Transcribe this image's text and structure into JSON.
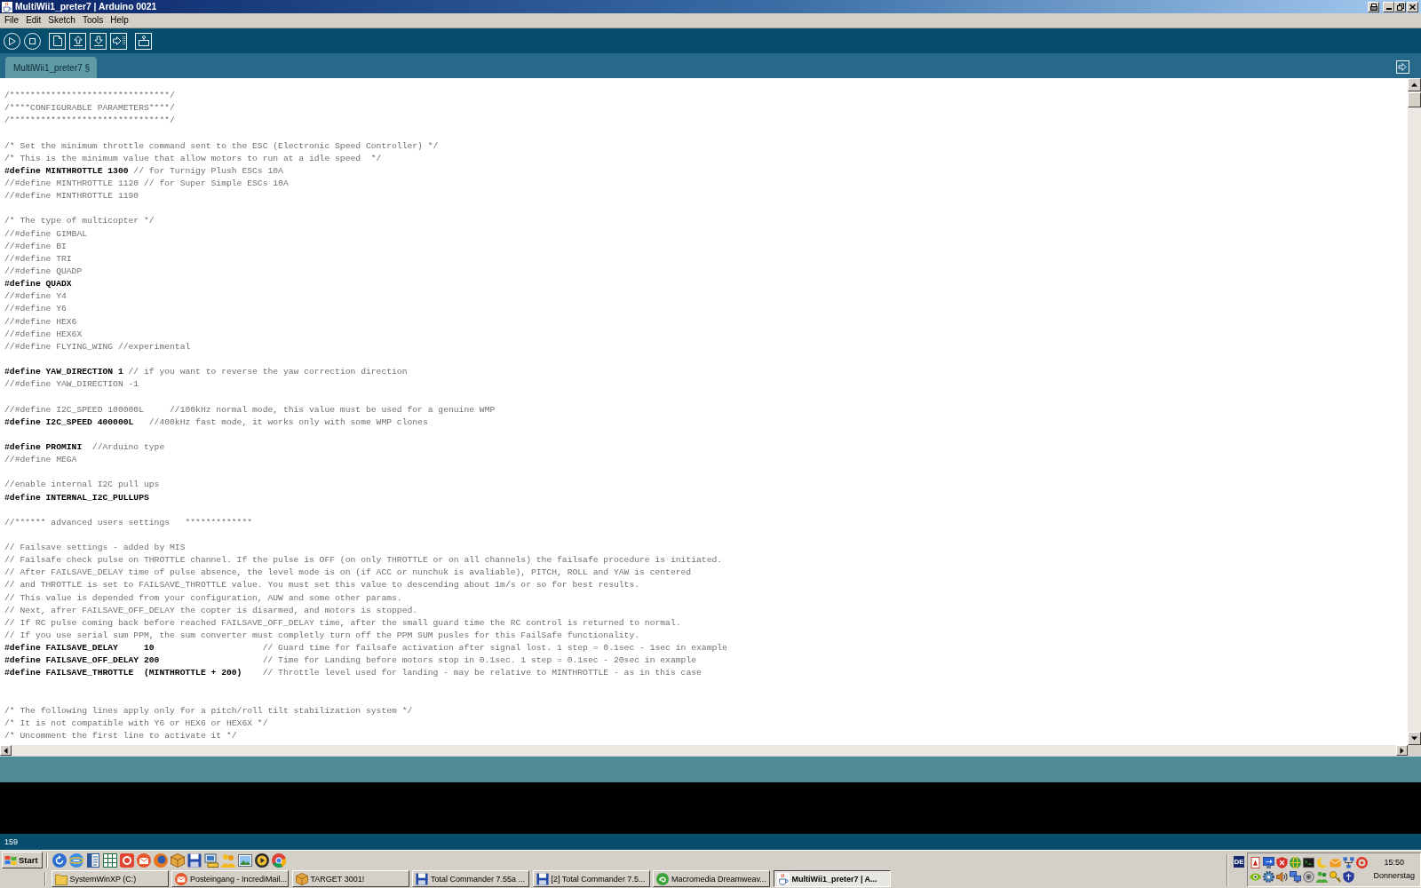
{
  "window": {
    "title": "MultiWii1_preter7 | Arduino 0021"
  },
  "menu": [
    "File",
    "Edit",
    "Sketch",
    "Tools",
    "Help"
  ],
  "tabs": [
    {
      "label": "MultiWii1_preter7 §",
      "selected": true
    }
  ],
  "editor": {
    "lines": [
      {
        "kind": "comment",
        "text": "/*******************************/"
      },
      {
        "kind": "comment",
        "text": "/****CONFIGURABLE PARAMETERS****/"
      },
      {
        "kind": "comment",
        "text": "/*******************************/"
      },
      {
        "kind": "blank"
      },
      {
        "kind": "comment",
        "text": "/* Set the minimum throttle command sent to the ESC (Electronic Speed Controller) */"
      },
      {
        "kind": "comment",
        "text": "/* This is the minimum value that allow motors to run at a idle speed  */"
      },
      {
        "kind": "mixed",
        "text": "**#define MINTHROTTLE 1300** // for Turnigy Plush ESCs 10A"
      },
      {
        "kind": "comment",
        "text": "//#define MINTHROTTLE 1120 // for Super Simple ESCs 10A"
      },
      {
        "kind": "comment",
        "text": "//#define MINTHROTTLE 1190"
      },
      {
        "kind": "blank"
      },
      {
        "kind": "comment",
        "text": "/* The type of multicopter */"
      },
      {
        "kind": "comment",
        "text": "//#define GIMBAL"
      },
      {
        "kind": "comment",
        "text": "//#define BI"
      },
      {
        "kind": "comment",
        "text": "//#define TRI"
      },
      {
        "kind": "comment",
        "text": "//#define QUADP"
      },
      {
        "kind": "directive",
        "text": "#define QUADX"
      },
      {
        "kind": "comment",
        "text": "//#define Y4"
      },
      {
        "kind": "comment",
        "text": "//#define Y6"
      },
      {
        "kind": "comment",
        "text": "//#define HEX6"
      },
      {
        "kind": "comment",
        "text": "//#define HEX6X"
      },
      {
        "kind": "comment",
        "text": "//#define FLYING_WING //experimental"
      },
      {
        "kind": "blank"
      },
      {
        "kind": "mixed",
        "text": "**#define YAW_DIRECTION 1** // if you want to reverse the yaw correction direction"
      },
      {
        "kind": "comment",
        "text": "//#define YAW_DIRECTION -1"
      },
      {
        "kind": "blank"
      },
      {
        "kind": "comment",
        "text": "//#define I2C_SPEED 100000L     //100kHz normal mode, this value must be used for a genuine WMP"
      },
      {
        "kind": "mixed",
        "text": "**#define I2C_SPEED 400000L**   //400kHz fast mode, it works only with some WMP clones"
      },
      {
        "kind": "blank"
      },
      {
        "kind": "mixed",
        "text": "**#define PROMINI**  //Arduino type"
      },
      {
        "kind": "comment",
        "text": "//#define MEGA"
      },
      {
        "kind": "blank"
      },
      {
        "kind": "comment",
        "text": "//enable internal I2C pull ups"
      },
      {
        "kind": "directive",
        "text": "#define INTERNAL_I2C_PULLUPS"
      },
      {
        "kind": "blank"
      },
      {
        "kind": "comment",
        "text": "//****** advanced users settings   *************"
      },
      {
        "kind": "blank"
      },
      {
        "kind": "comment",
        "text": "// Failsave settings - added by MIS"
      },
      {
        "kind": "comment",
        "text": "// Failsafe check pulse on THROTTLE channel. If the pulse is OFF (on only THROTTLE or on all channels) the failsafe procedure is initiated."
      },
      {
        "kind": "comment",
        "text": "// After FAILSAVE_DELAY time of pulse absence, the level mode is on (if ACC or nunchuk is avaliable), PITCH, ROLL and YAW is centered"
      },
      {
        "kind": "comment",
        "text": "// and THROTTLE is set to FAILSAVE_THROTTLE value. You must set this value to descending about 1m/s or so for best results."
      },
      {
        "kind": "comment",
        "text": "// This value is depended from your configuration, AUW and some other params."
      },
      {
        "kind": "comment",
        "text": "// Next, afrer FAILSAVE_OFF_DELAY the copter is disarmed, and motors is stopped."
      },
      {
        "kind": "comment",
        "text": "// If RC pulse coming back before reached FAILSAVE_OFF_DELAY time, after the small guard time the RC control is returned to normal."
      },
      {
        "kind": "comment",
        "text": "// If you use serial sum PPM, the sum converter must completly turn off the PPM SUM pusles for this FailSafe functionality."
      },
      {
        "kind": "mixed",
        "text": "**#define FAILSAVE_DELAY     10**                     // Guard time for failsafe activation after signal lost. 1 step = 0.1sec - 1sec in example"
      },
      {
        "kind": "mixed",
        "text": "**#define FAILSAVE_OFF_DELAY 200**                    // Time for Landing before motors stop in 0.1sec. 1 step = 0.1sec - 20sec in example"
      },
      {
        "kind": "mixed",
        "text": "**#define FAILSAVE_THROTTLE  (MINTHROTTLE + 200)**    // Throttle level used for landing - may be relative to MINTHROTTLE - as in this case"
      },
      {
        "kind": "blank"
      },
      {
        "kind": "blank"
      },
      {
        "kind": "comment",
        "text": "/* The following lines apply only for a pitch/roll tilt stabilization system */"
      },
      {
        "kind": "comment",
        "text": "/* It is not compatible with Y6 or HEX6 or HEX6X */"
      },
      {
        "kind": "comment",
        "text": "/* Uncomment the first line to activate it */"
      }
    ]
  },
  "status_bar": {
    "line_number": "159"
  },
  "taskbar": {
    "start_label": "Start",
    "tasks": [
      {
        "label": "SystemWinXP (C:)",
        "selected": false
      },
      {
        "label": "Posteingang - IncrediMail...",
        "selected": false
      },
      {
        "label": "TARGET 3001!",
        "selected": false
      },
      {
        "label": "Total Commander 7.55a ...",
        "selected": false
      },
      {
        "label": "[2] Total Commander 7.5...",
        "selected": false
      },
      {
        "label": "Macromedia Dreamweav...",
        "selected": false
      },
      {
        "label": "MultiWii1_preter7 | A...",
        "selected": true
      }
    ],
    "tray": {
      "language": "DE",
      "time": "15:50",
      "day": "Donnerstag"
    }
  }
}
